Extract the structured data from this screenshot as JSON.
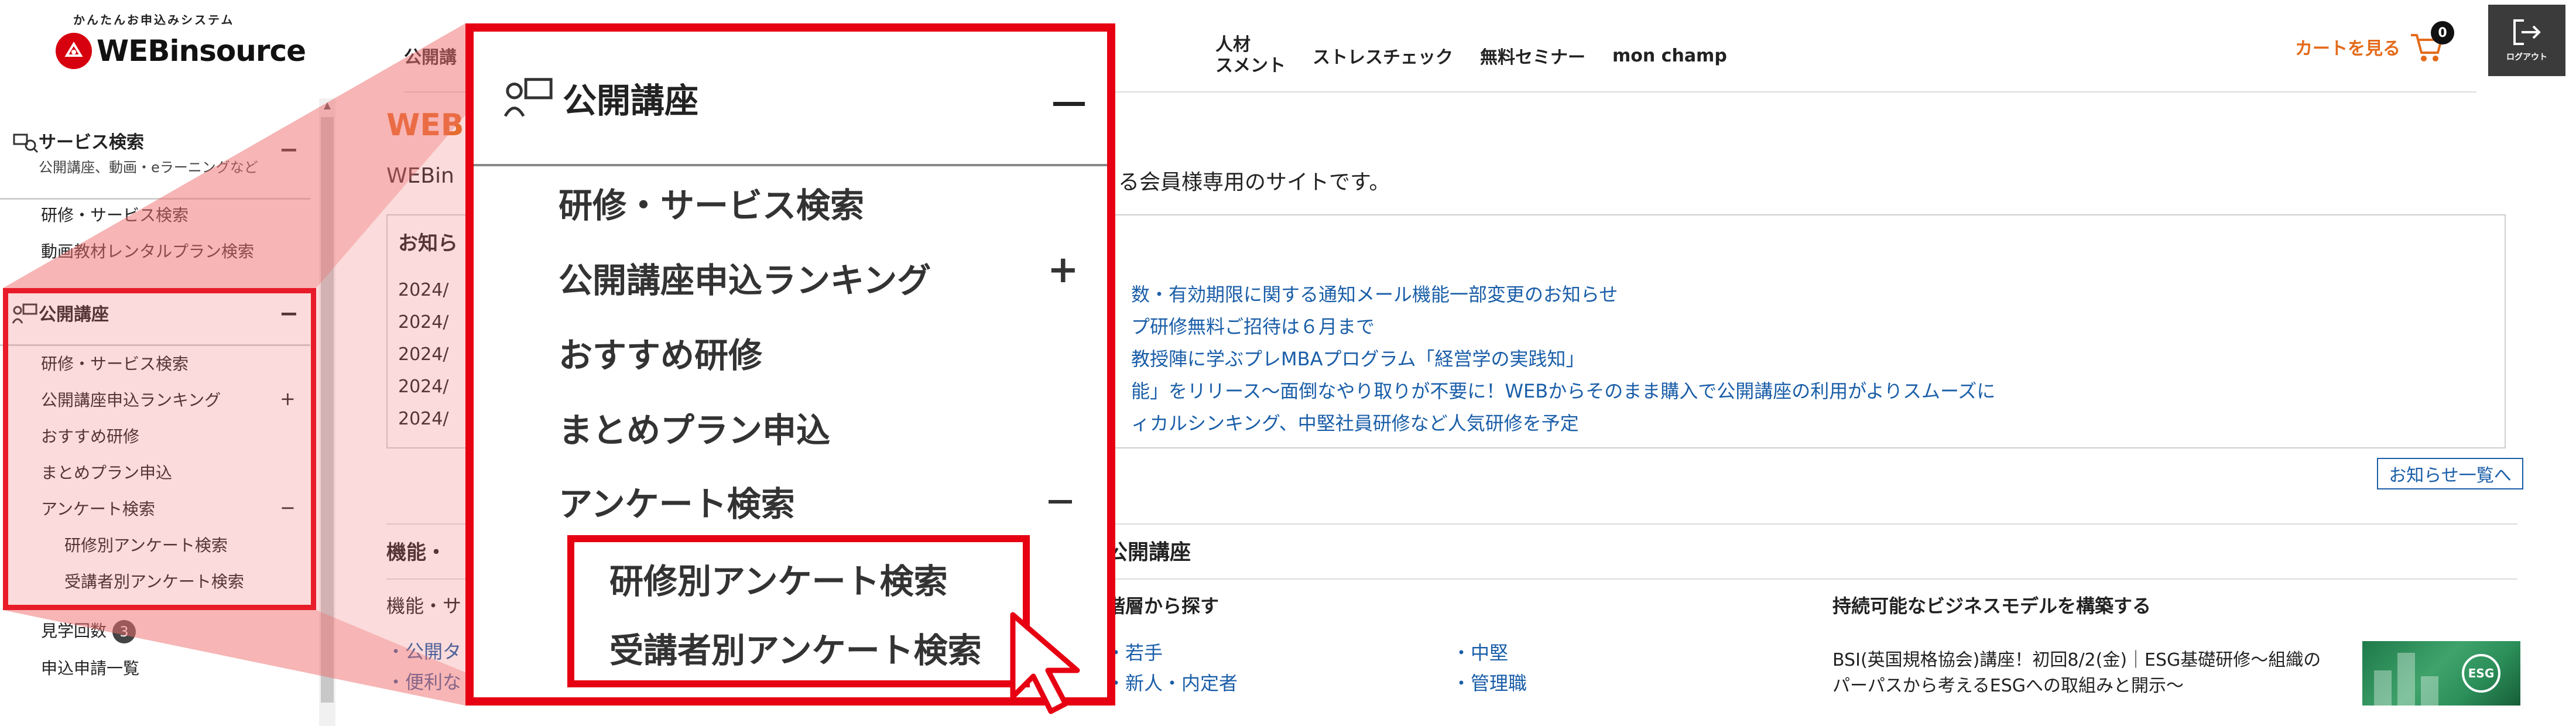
{
  "header": {
    "logo_tagline": "かんたんお申込みシステム",
    "logo_text": "WEBinsource",
    "nav": [
      {
        "label": "公開講"
      },
      {
        "line1": "人材",
        "line2": "スメント"
      },
      {
        "label": "ストレスチェック"
      },
      {
        "label": "無料セミナー"
      },
      {
        "label": "mon champ"
      }
    ],
    "cart_label": "カートを見る",
    "cart_count": "0",
    "logout_label": "ログアウト"
  },
  "sidebar": {
    "service_search": {
      "title": "サービス検索",
      "subtitle": "公開講座、動画・eラーニングなど",
      "toggle": "−"
    },
    "service_links": [
      "研修・サービス検索",
      "動画教材レンタルプラン検索"
    ],
    "public_course": {
      "title": "公開講座",
      "toggle": "−"
    },
    "public_links": [
      {
        "label": "研修・サービス検索"
      },
      {
        "label": "公開講座申込ランキング",
        "toggle": "+"
      },
      {
        "label": "おすすめ研修"
      },
      {
        "label": "まとめプラン申込"
      },
      {
        "label": "アンケート検索",
        "toggle": "−"
      }
    ],
    "survey_sublinks": [
      "研修別アンケート検索",
      "受講者別アンケート検索"
    ],
    "other_links": [
      {
        "label": "見学回数",
        "badge": "3"
      },
      {
        "label": "申込申請一覧"
      }
    ]
  },
  "main": {
    "page_title": "WEB",
    "welcome_head": "WEBin",
    "welcome_tail": "る会員様専用のサイトです。",
    "news": {
      "title": "お知ら",
      "dates": [
        "2024/",
        "2024/",
        "2024/",
        "2024/",
        "2024/"
      ],
      "items": [
        "数・有効期限に関する通知メール機能一部変更のお知らせ",
        "プ研修無料ご招待は６月まで",
        "教授陣に学ぶプレMBAプログラム「経営学の実践知」",
        "能」をリリース〜面倒なやり取りが不要に！WEBからそのまま購入で公開講座の利用がよりスムーズに",
        "ィカルシンキング、中堅社員研修など人気研修を予定"
      ],
      "more": "お知らせ一覧へ"
    },
    "left_section": {
      "title": "機能・",
      "subtitle": "機能・サ",
      "links": [
        "・公開タ",
        "・便利な"
      ]
    },
    "right_section": {
      "title": "公開講座",
      "col1_head": "階層から探す",
      "col1_links": [
        "・若手",
        "・新人・内定者"
      ],
      "col2_links": [
        "・中堅",
        "・管理職"
      ],
      "col3_head": "持続可能なビジネスモデルを構築する",
      "col3_text": "BSI(英国規格協会)講座！初回8/2(金)｜ESG基礎研修〜組織のパーパスから考えるESGへの取組みと開示〜",
      "esg_badge": "ESG"
    }
  },
  "callout": {
    "title": "公開講座",
    "items": [
      {
        "label": "研修・サービス検索"
      },
      {
        "label": "公開講座申込ランキング",
        "toggle": "+"
      },
      {
        "label": "おすすめ研修"
      },
      {
        "label": "まとめプラン申込"
      },
      {
        "label": "アンケート検索",
        "toggle": "−"
      }
    ],
    "sub_items": [
      "研修別アンケート検索",
      "受講者別アンケート検索"
    ]
  },
  "colors": {
    "accent_orange": "#e36b1a",
    "highlight_red": "#e60012",
    "link_blue": "#1a5ea8",
    "logo_red": "#d7000f"
  },
  "icons": [
    "logo-mark-icon",
    "cart-icon",
    "logout-icon",
    "service-search-icon",
    "public-course-icon",
    "pointer-cursor-icon"
  ]
}
